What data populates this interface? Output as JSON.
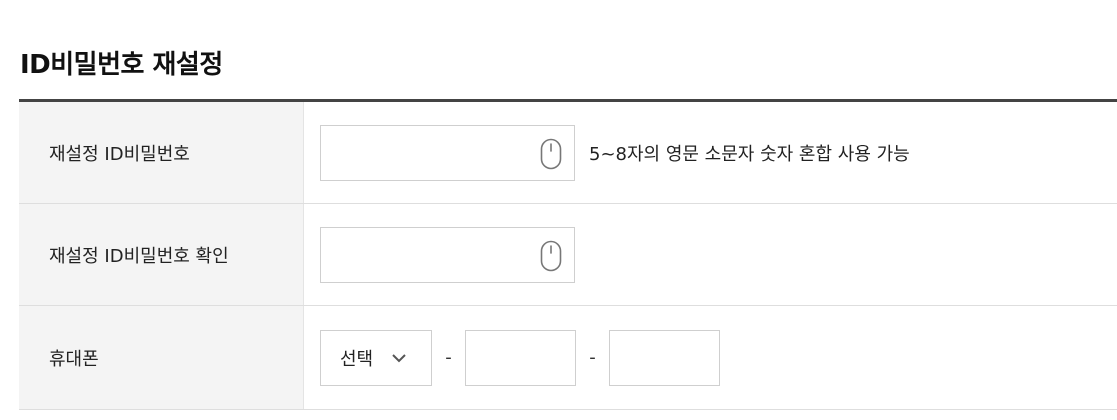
{
  "page": {
    "title": "ID비밀번호 재설정"
  },
  "form": {
    "new_password": {
      "label": "재설정 ID비밀번호",
      "value": "",
      "hint": "5~8자의 영문 소문자 숫자 혼합 사용 가능",
      "icon": "mouse-icon"
    },
    "confirm_password": {
      "label": "재설정 ID비밀번호 확인",
      "value": "",
      "icon": "mouse-icon"
    },
    "mobile": {
      "label": "휴대폰",
      "carrier_select": "선택",
      "separator": "-",
      "middle": "",
      "last": ""
    }
  }
}
